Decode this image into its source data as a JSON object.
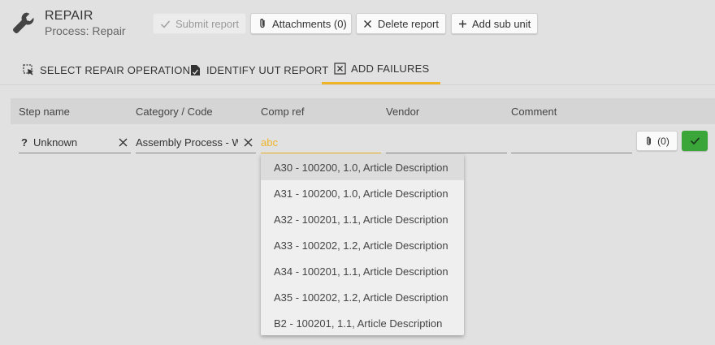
{
  "header": {
    "title": "REPAIR",
    "subtitle": "Process: Repair"
  },
  "toolbar": {
    "submit_label": "Submit report",
    "attachments_label": "Attachments (0)",
    "delete_label": "Delete report",
    "add_sub_unit_label": "Add sub unit"
  },
  "tabs": [
    {
      "label": "SELECT REPAIR OPERATION",
      "icon": "select-cursor-icon"
    },
    {
      "label": "IDENTIFY UUT REPORT",
      "icon": "document-icon"
    },
    {
      "label": "ADD FAILURES",
      "icon": "failure-x-icon",
      "active": true
    }
  ],
  "table": {
    "columns": [
      "Step name",
      "Category / Code",
      "Comp ref",
      "Vendor",
      "Comment"
    ]
  },
  "row": {
    "step_prefix": "?",
    "step_name": "Unknown",
    "category": "Assembly Process - Wr",
    "comp_ref_placeholder": "abc",
    "comp_ref_value": "",
    "vendor": "",
    "comment": "",
    "attach_count": "(0)"
  },
  "dropdown": {
    "options": [
      "A30 - 100200, 1.0, Article Description",
      "A31 - 100200, 1.0, Article Description",
      "A32 - 100201, 1.1, Article Description",
      "A33 - 100202, 1.2, Article Description",
      "A34 - 100201, 1.1, Article Description",
      "A35 - 100202, 1.2, Article Description",
      "B2 - 100201, 1.1, Article Description"
    ],
    "highlighted_index": 0
  },
  "colors": {
    "accent": "#f0b429",
    "ok_green": "#3aa63a",
    "background": "#e1e1e1"
  }
}
